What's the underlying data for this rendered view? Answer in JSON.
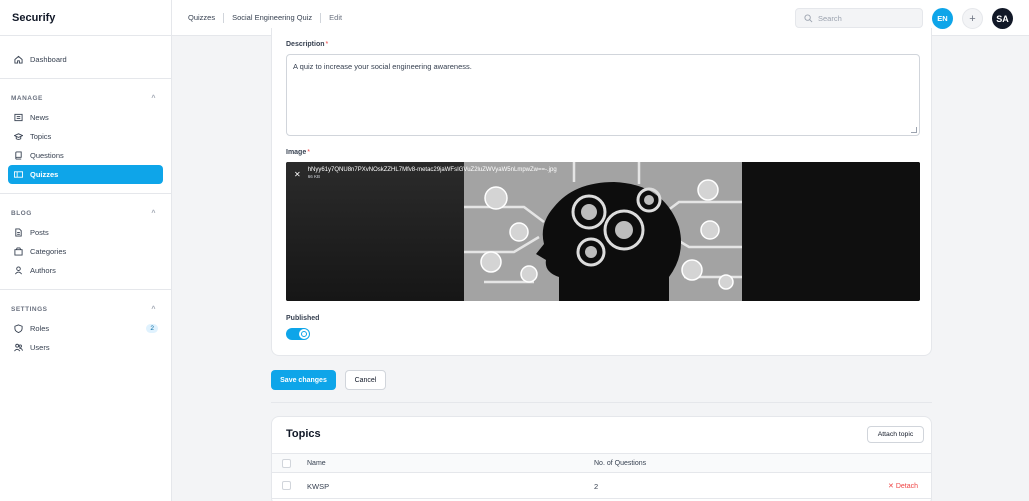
{
  "brand": "Securify",
  "sidebar": {
    "dashboard": "Dashboard",
    "groups": [
      {
        "title": "MANAGE",
        "items": [
          {
            "label": "News",
            "icon": "newspaper-icon"
          },
          {
            "label": "Topics",
            "icon": "graduation-cap-icon"
          },
          {
            "label": "Questions",
            "icon": "book-icon"
          },
          {
            "label": "Quizzes",
            "icon": "rectangle-icon",
            "active": true
          }
        ]
      },
      {
        "title": "BLOG",
        "items": [
          {
            "label": "Posts",
            "icon": "document-icon"
          },
          {
            "label": "Categories",
            "icon": "folder-icon"
          },
          {
            "label": "Authors",
            "icon": "users-icon"
          }
        ]
      },
      {
        "title": "SETTINGS",
        "items": [
          {
            "label": "Roles",
            "icon": "shield-icon",
            "badge": "2"
          },
          {
            "label": "Users",
            "icon": "user-group-icon"
          }
        ]
      }
    ]
  },
  "topbar": {
    "breadcrumbs": [
      "Quizzes",
      "Social Engineering Quiz",
      "Edit"
    ],
    "search_placeholder": "Search",
    "lang": "EN",
    "plus": "+",
    "avatar": "SA"
  },
  "form": {
    "description_label": "Description",
    "description_value": "A quiz to increase your social engineering awareness.",
    "image_label": "Image",
    "image_file_name": "hNyy61y7QNU8n7PXvNOskZZHL7Mfv8-metac29jaWFsIGVuZ2luZWVyaW5nLmpwZw==-.jpg",
    "image_file_size": "66 KB",
    "published_label": "Published",
    "published": true,
    "required_mark": "*"
  },
  "actions": {
    "save": "Save changes",
    "cancel": "Cancel"
  },
  "topics": {
    "title": "Topics",
    "attach": "Attach topic",
    "columns": [
      "Name",
      "No. of Questions"
    ],
    "rows": [
      {
        "name": "KWSP",
        "count": "2"
      }
    ],
    "detach": "Detach"
  },
  "colors": {
    "accent": "#0ea5e9",
    "danger": "#ef4444"
  }
}
